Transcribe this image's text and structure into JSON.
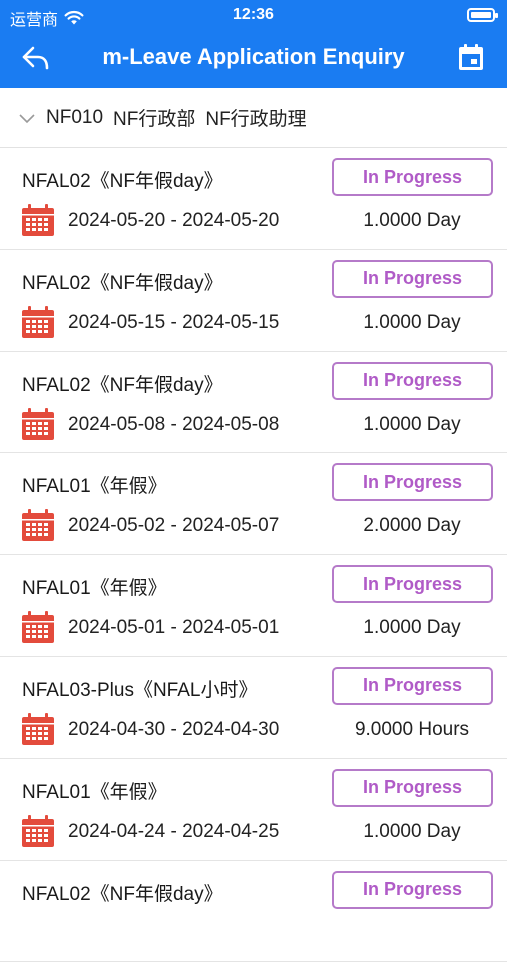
{
  "status_bar": {
    "carrier": "运营商",
    "time": "12:36"
  },
  "header": {
    "title": "m-Leave Application Enquiry"
  },
  "department": {
    "code": "NF010",
    "name": "NF行政部",
    "position": "NF行政助理"
  },
  "colors": {
    "header_bg": "#1a7cf2",
    "status_badge": "#b05bc7",
    "calendar_icon": "#e34b3c"
  },
  "icons": {
    "back": "back-arrow-icon",
    "calendar_header": "calendar-icon",
    "expand": "chevron-down-icon",
    "row_calendar": "calendar-icon"
  },
  "leaves": [
    {
      "name": "NFAL02《NF年假day》",
      "status": "In Progress",
      "dates": "2024-05-20 - 2024-05-20",
      "duration": "1.0000 Day"
    },
    {
      "name": "NFAL02《NF年假day》",
      "status": "In Progress",
      "dates": "2024-05-15 - 2024-05-15",
      "duration": "1.0000 Day"
    },
    {
      "name": "NFAL02《NF年假day》",
      "status": "In Progress",
      "dates": "2024-05-08 - 2024-05-08",
      "duration": "1.0000 Day"
    },
    {
      "name": "NFAL01《年假》",
      "status": "In Progress",
      "dates": "2024-05-02 - 2024-05-07",
      "duration": "2.0000 Day"
    },
    {
      "name": "NFAL01《年假》",
      "status": "In Progress",
      "dates": "2024-05-01 - 2024-05-01",
      "duration": "1.0000 Day"
    },
    {
      "name": "NFAL03-Plus《NFAL小时》",
      "status": "In Progress",
      "dates": "2024-04-30 - 2024-04-30",
      "duration": "9.0000 Hours"
    },
    {
      "name": "NFAL01《年假》",
      "status": "In Progress",
      "dates": "2024-04-24 - 2024-04-25",
      "duration": "1.0000 Day"
    },
    {
      "name": "NFAL02《NF年假day》",
      "status": "In Progress",
      "dates": "",
      "duration": ""
    }
  ]
}
